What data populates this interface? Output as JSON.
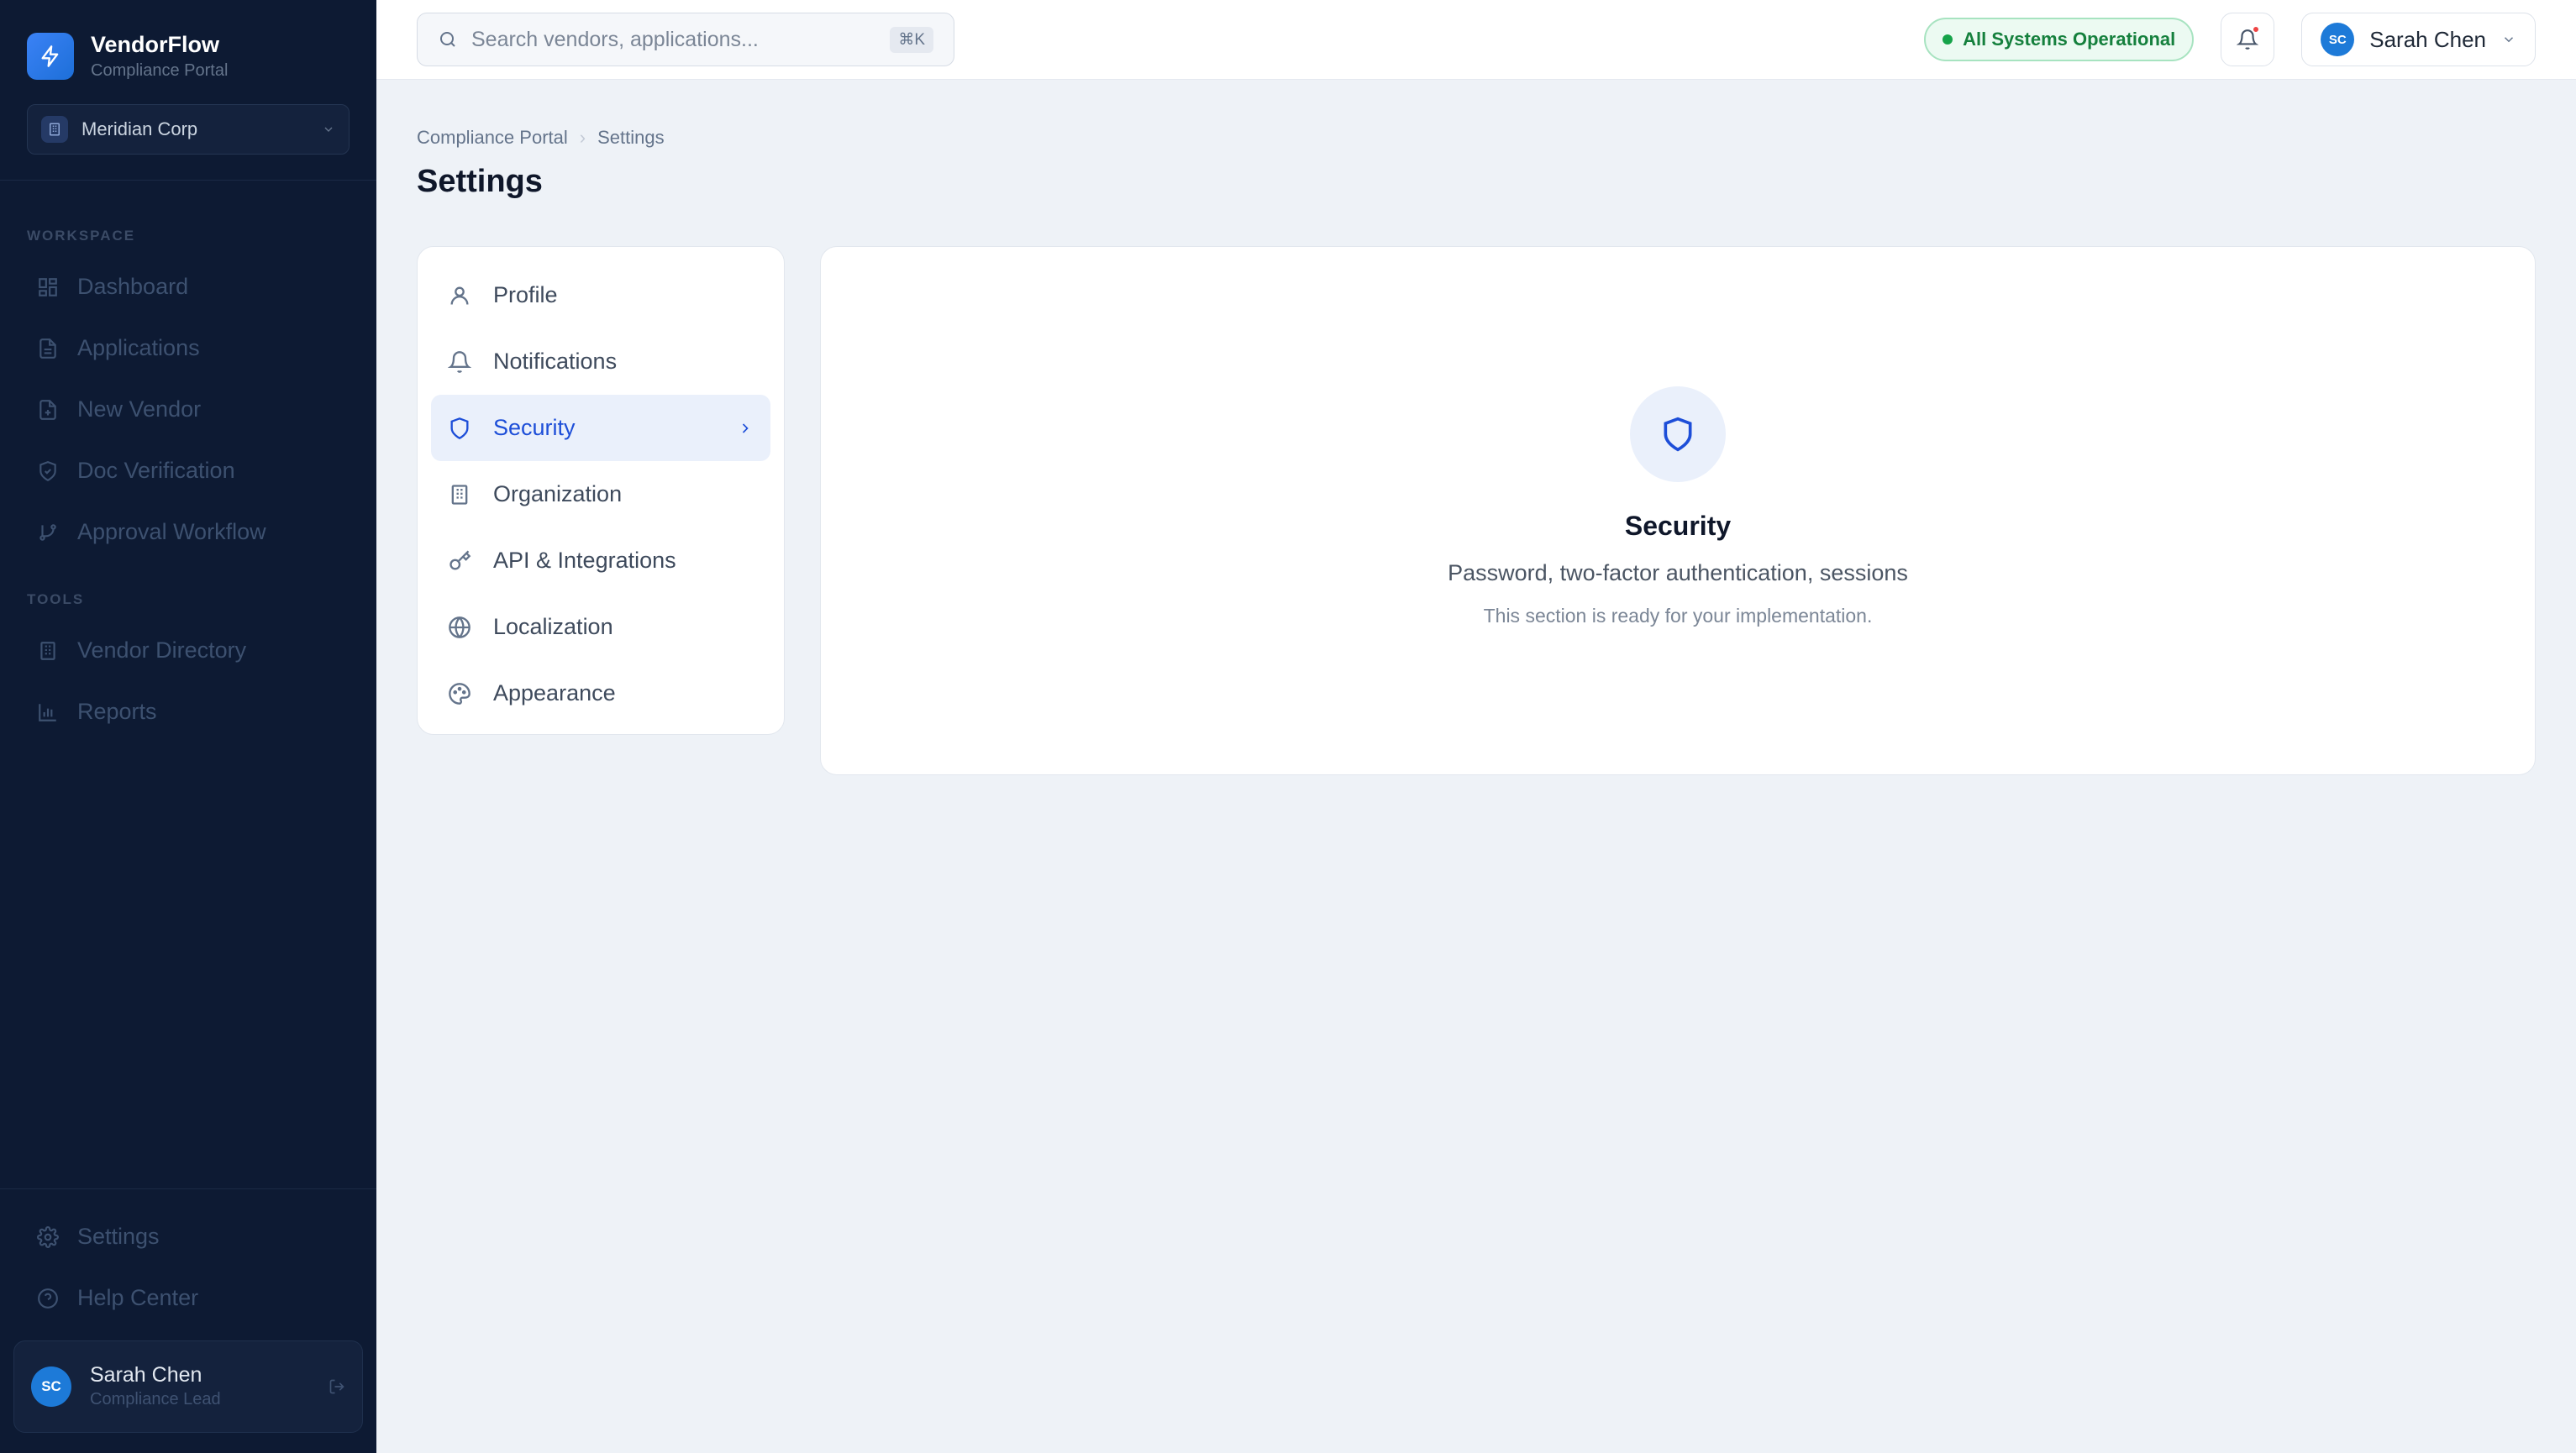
{
  "brand": {
    "name": "VendorFlow",
    "subtitle": "Compliance Portal",
    "accent": "#3b82f6"
  },
  "org": {
    "name": "Meridian Corp"
  },
  "sidebar": {
    "workspace_label": "WORKSPACE",
    "workspace_items": [
      {
        "label": "Dashboard",
        "icon": "grid-icon"
      },
      {
        "label": "Applications",
        "icon": "document-icon"
      },
      {
        "label": "New Vendor",
        "icon": "document-plus-icon"
      },
      {
        "label": "Doc Verification",
        "icon": "shield-check-icon"
      },
      {
        "label": "Approval Workflow",
        "icon": "branch-icon"
      }
    ],
    "tools_label": "TOOLS",
    "tools_items": [
      {
        "label": "Vendor Directory",
        "icon": "building-icon"
      },
      {
        "label": "Reports",
        "icon": "bar-chart-icon"
      }
    ],
    "bottom_items": [
      {
        "label": "Settings",
        "icon": "gear-icon"
      },
      {
        "label": "Help Center",
        "icon": "help-icon"
      }
    ],
    "user": {
      "initials": "SC",
      "name": "Sarah Chen",
      "role": "Compliance Lead"
    }
  },
  "topbar": {
    "search_placeholder": "Search vendors, applications...",
    "search_shortcut": "⌘K",
    "status": "All Systems Operational",
    "status_color": "#16a34a",
    "user": {
      "initials": "SC",
      "name": "Sarah Chen"
    }
  },
  "breadcrumb": [
    "Compliance Portal",
    "Settings"
  ],
  "page_title": "Settings",
  "settings_nav": [
    {
      "label": "Profile",
      "icon": "user-icon"
    },
    {
      "label": "Notifications",
      "icon": "bell-icon"
    },
    {
      "label": "Security",
      "icon": "shield-icon",
      "active": true
    },
    {
      "label": "Organization",
      "icon": "building-icon"
    },
    {
      "label": "API & Integrations",
      "icon": "key-icon"
    },
    {
      "label": "Localization",
      "icon": "globe-icon"
    },
    {
      "label": "Appearance",
      "icon": "palette-icon"
    }
  ],
  "content": {
    "title": "Security",
    "subtitle": "Password, two-factor authentication, sessions",
    "note": "This section is ready for your implementation."
  }
}
